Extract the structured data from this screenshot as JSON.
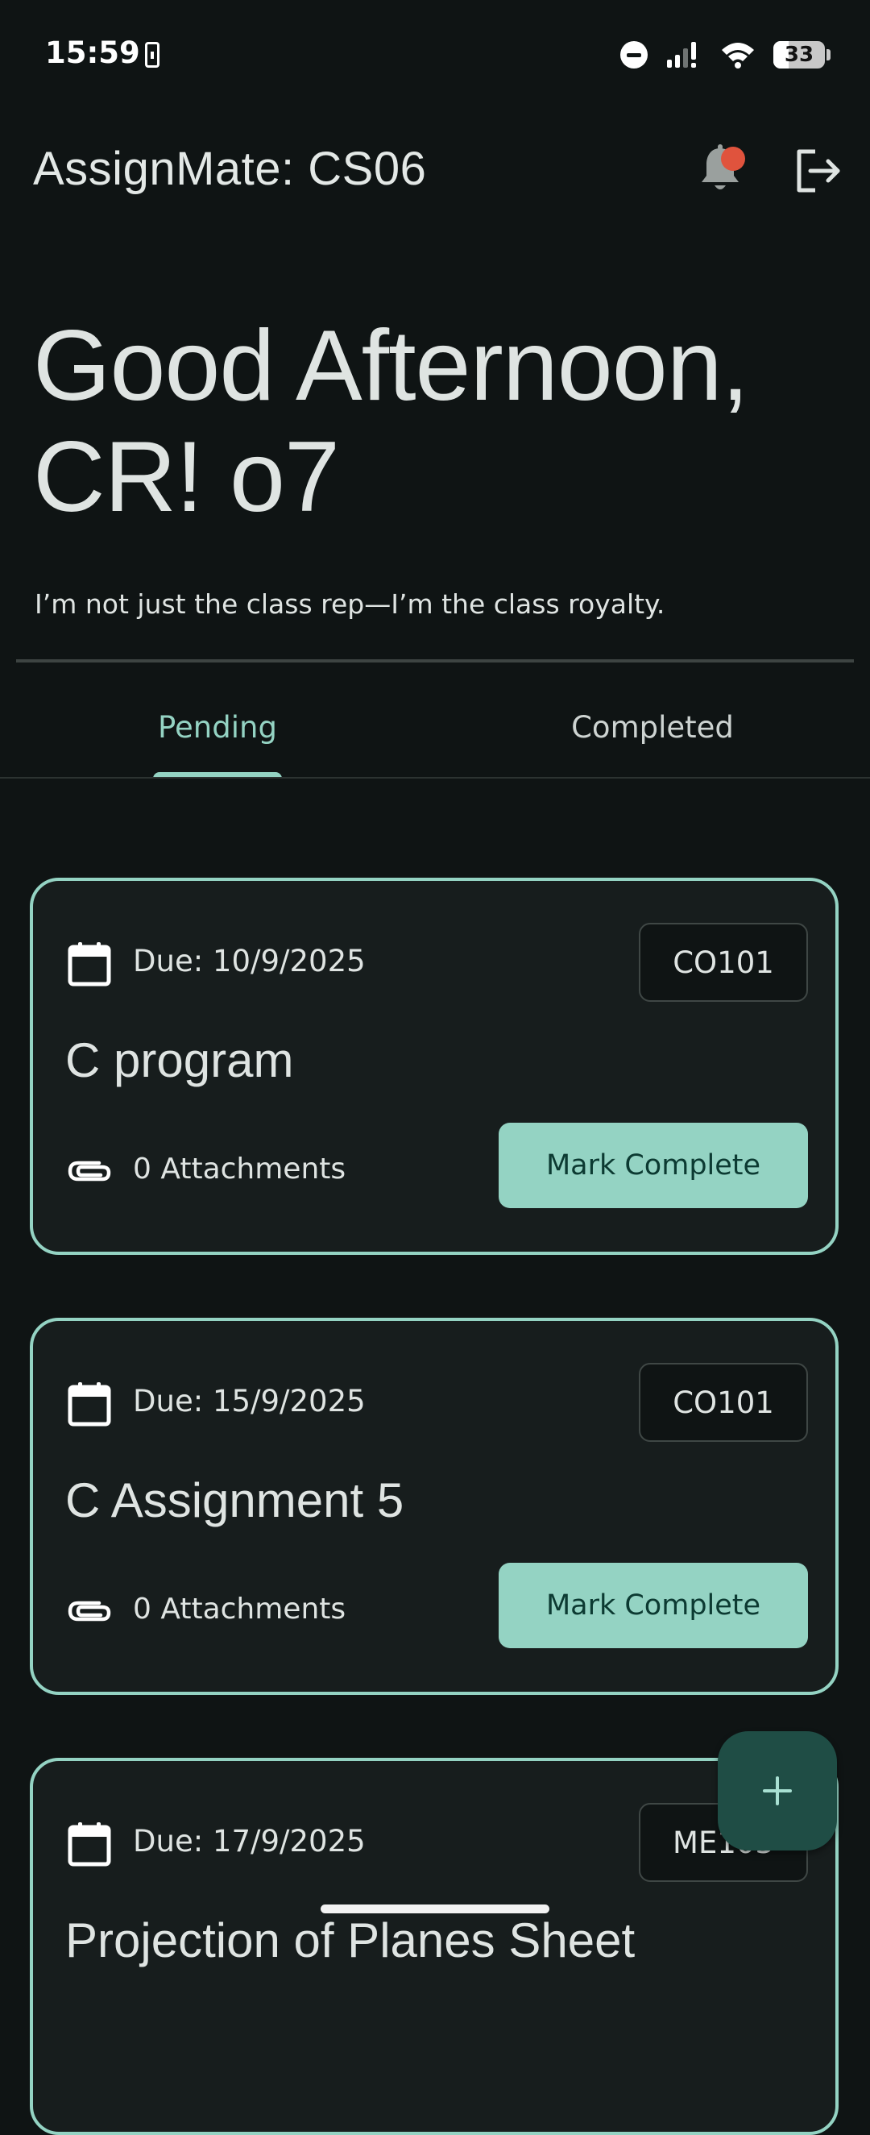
{
  "status_bar": {
    "time": "15:59",
    "battery": "33"
  },
  "app_bar": {
    "title": "AssignMate: CS06",
    "icons": [
      "bell-icon",
      "logout-icon"
    ]
  },
  "greeting": {
    "line1": "Good Afternoon,",
    "line2": "CR! o7",
    "subtitle": "I’m not just the class rep—I’m the class royalty."
  },
  "tabs": [
    {
      "label": "Pending",
      "selected": true
    },
    {
      "label": "Completed",
      "selected": false
    }
  ],
  "cards": [
    {
      "due": "Due: 10/9/2025",
      "code": "CO101",
      "title": "C program",
      "attachments": "0 Attachments",
      "action": "Mark Complete"
    },
    {
      "due": "Due: 15/9/2025",
      "code": "CO101",
      "title": "C Assignment 5",
      "attachments": "0 Attachments",
      "action": "Mark Complete"
    },
    {
      "due": "Due: 17/9/2025",
      "code": "ME103",
      "title": "Projection of Planes Sheet",
      "attachments": "",
      "action": ""
    }
  ],
  "fab": {
    "icon": "plus-icon"
  },
  "colors": {
    "background": "#0f1414",
    "accent": "#94d3c3",
    "card_background": "#171d1d",
    "badge": "#e0533d",
    "fab": "#1f4d45"
  }
}
